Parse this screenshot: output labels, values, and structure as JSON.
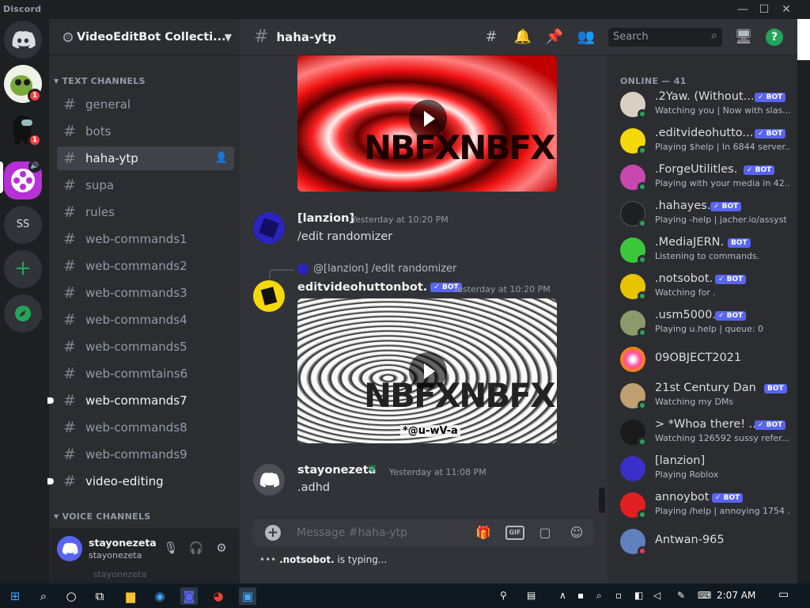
{
  "app": {
    "title": "Discord"
  },
  "window": {
    "minimize": "—",
    "maximize": "☐",
    "close": "✕"
  },
  "guilds": {
    "badge1": "1",
    "badge2": "1",
    "ss_label": "SS"
  },
  "server": {
    "name": "VideoEditBot Collecti...",
    "boost": "0"
  },
  "categories": {
    "text": "TEXT CHANNELS",
    "voice": "VOICE CHANNELS"
  },
  "channels": [
    {
      "name": "general"
    },
    {
      "name": "bots"
    },
    {
      "name": "haha-ytp"
    },
    {
      "name": "supa"
    },
    {
      "name": "rules"
    },
    {
      "name": "web-commands1"
    },
    {
      "name": "web-commands2"
    },
    {
      "name": "web-commands3"
    },
    {
      "name": "web-commands4"
    },
    {
      "name": "web-commands5"
    },
    {
      "name": "web-commtains6"
    },
    {
      "name": "web-commands7"
    },
    {
      "name": "web-commands8"
    },
    {
      "name": "web-commands9"
    },
    {
      "name": "video-editing"
    }
  ],
  "user": {
    "name": "stayonezeta",
    "status": "stayonezeta",
    "ghost": "stayonezeta"
  },
  "header": {
    "channel": "haha-ytp",
    "search_placeholder": "Search",
    "help": "?"
  },
  "messages": [
    {
      "author": "[lanzion]",
      "time": "Yesterday at 10:20 PM",
      "text": "/edit randomizer"
    },
    {
      "reply_to": "@[lanzion]  /edit randomizer",
      "author": "editvideohuttonbot.",
      "bot": "✓ BOT",
      "time": "Yesterday at 10:20 PM"
    },
    {
      "author": "stayonezeta",
      "time": "Yesterday at 11:08 PM",
      "text": ".adhd"
    }
  ],
  "video_text": {
    "top": "NBFXNBFX",
    "bottom": "NBFXNBFX",
    "caption": "*@u-wV-a"
  },
  "composer": {
    "placeholder": "Message #haha-ytp",
    "gif": "GIF"
  },
  "typing": {
    "user": ".notsobot.",
    "suffix": " is typing..."
  },
  "members": {
    "header": "ONLINE — 41",
    "list": [
      {
        "name": ".2Yaw. (Without...",
        "bot": "✓ BOT",
        "activity": "Watching you | Now with slas...",
        "color": "#d9d0c3"
      },
      {
        "name": ".editvideohutto...",
        "bot": "✓ BOT",
        "activity": "Playing $help | In 6844 server...",
        "color": "#f5d90a"
      },
      {
        "name": ".ForgeUtilitles.",
        "bot": "✓ BOT",
        "activity": "Playing with your media in 42...",
        "color": "#c848b0"
      },
      {
        "name": ".hahayes.",
        "bot": "✓ BOT",
        "activity": "Playing -help | jacher.io/assyst",
        "color": "#2b2d31"
      },
      {
        "name": ".MediaJERN.",
        "bot": "BOT",
        "activity": "Listening to commands.",
        "color": "#3cc63c"
      },
      {
        "name": ".notsobot.",
        "bot": "✓ BOT",
        "activity": "Watching for .",
        "color": "#e8c400"
      },
      {
        "name": ".usm5000.",
        "bot": "✓ BOT",
        "activity": "Playing u.help | queue: 0",
        "color": "#8a9a6a"
      },
      {
        "name": "09OBJECT2021",
        "bot": "",
        "activity": "",
        "color": "#ff4fa0"
      },
      {
        "name": "21st Century Dan...",
        "bot": "BOT",
        "activity": "Watching my DMs",
        "color": "#c0a070"
      },
      {
        "name": "> *Whoa there! ...",
        "bot": "✓ BOT",
        "activity": "Watching 126592 sussy refer...",
        "color": "#1a1a1a"
      },
      {
        "name": "[lanzion]",
        "bot": "",
        "activity": "Playing Roblox",
        "color": "#3a2fc8"
      },
      {
        "name": "annoybot",
        "bot": "✓ BOT",
        "activity": "Playing /help | annoying 1754 ...",
        "color": "#e02020"
      },
      {
        "name": "Antwan-965",
        "bot": "",
        "activity": "",
        "color": "#6080c0"
      }
    ]
  },
  "taskbar": {
    "time": "2:07 AM"
  }
}
